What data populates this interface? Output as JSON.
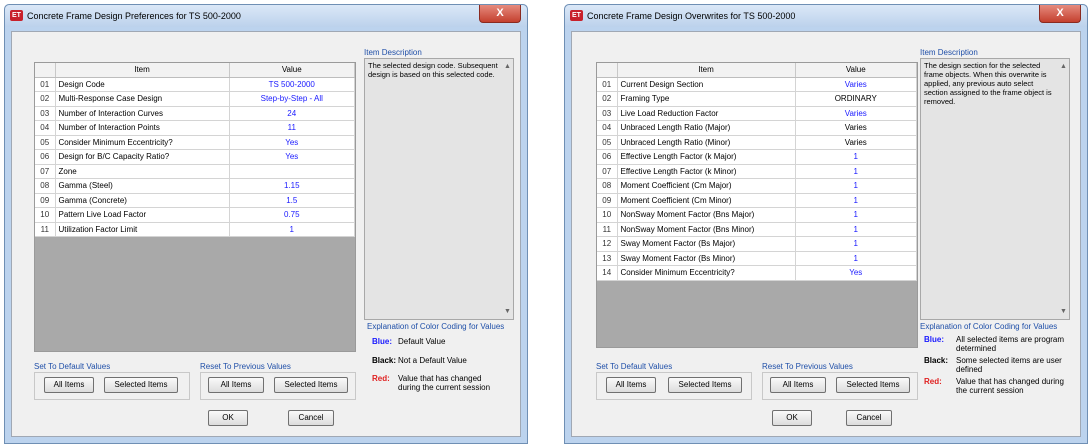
{
  "colors": {
    "blue": "#1a1aff",
    "black": "#000000",
    "red": "#e02020",
    "header_blue": "#1f4fa8"
  },
  "left": {
    "title": "Concrete Frame Design Preferences for TS 500-2000",
    "close_label": "X",
    "columns": {
      "item": "Item",
      "value": "Value"
    },
    "rows": [
      {
        "num": "01",
        "item": "Design Code",
        "value": "TS 500-2000",
        "color": "blue"
      },
      {
        "num": "02",
        "item": "Multi-Response Case Design",
        "value": "Step-by-Step - All",
        "color": "blue"
      },
      {
        "num": "03",
        "item": "Number of Interaction Curves",
        "value": "24",
        "color": "blue"
      },
      {
        "num": "04",
        "item": "Number of Interaction Points",
        "value": "11",
        "color": "blue"
      },
      {
        "num": "05",
        "item": "Consider Minimum Eccentricity?",
        "value": "Yes",
        "color": "blue"
      },
      {
        "num": "06",
        "item": "Design for B/C Capacity Ratio?",
        "value": "Yes",
        "color": "blue"
      },
      {
        "num": "07",
        "item": "Zone",
        "value": "",
        "color": "blue"
      },
      {
        "num": "08",
        "item": "Gamma (Steel)",
        "value": "1.15",
        "color": "blue"
      },
      {
        "num": "09",
        "item": "Gamma (Concrete)",
        "value": "1.5",
        "color": "blue"
      },
      {
        "num": "10",
        "item": "Pattern Live Load Factor",
        "value": "0.75",
        "color": "blue"
      },
      {
        "num": "11",
        "item": "Utilization Factor Limit",
        "value": "1",
        "color": "blue"
      }
    ],
    "item_description_label": "Item Description",
    "item_description": "The selected design code.  Subsequent design is based on this selected code.",
    "explanation_label": "Explanation of Color Coding for Values",
    "legend": [
      {
        "key": "Blue:",
        "text": "Default Value",
        "color": "blue"
      },
      {
        "key": "Black:",
        "text": "Not a Default Value",
        "color": "black"
      },
      {
        "key": "Red:",
        "text": "Value that has changed during the current session",
        "color": "red"
      }
    ],
    "set_default_label": "Set To Default Values",
    "reset_previous_label": "Reset To Previous Values",
    "all_items": "All Items",
    "selected_items": "Selected Items",
    "ok": "OK",
    "cancel": "Cancel"
  },
  "right": {
    "title": "Concrete Frame Design Overwrites for TS 500-2000",
    "close_label": "X",
    "columns": {
      "item": "Item",
      "value": "Value"
    },
    "rows": [
      {
        "num": "01",
        "item": "Current Design Section",
        "value": "Varies",
        "color": "blue"
      },
      {
        "num": "02",
        "item": "Framing Type",
        "value": "ORDINARY",
        "color": "black"
      },
      {
        "num": "03",
        "item": "Live Load Reduction Factor",
        "value": "Varies",
        "color": "blue"
      },
      {
        "num": "04",
        "item": "Unbraced Length Ratio (Major)",
        "value": "Varies",
        "color": "black"
      },
      {
        "num": "05",
        "item": "Unbraced Length Ratio (Minor)",
        "value": "Varies",
        "color": "black"
      },
      {
        "num": "06",
        "item": "Effective Length Factor (k Major)",
        "value": "1",
        "color": "blue"
      },
      {
        "num": "07",
        "item": "Effective Length Factor (k Minor)",
        "value": "1",
        "color": "blue"
      },
      {
        "num": "08",
        "item": "Moment Coefficient (Cm Major)",
        "value": "1",
        "color": "blue"
      },
      {
        "num": "09",
        "item": "Moment Coefficient (Cm Minor)",
        "value": "1",
        "color": "blue"
      },
      {
        "num": "10",
        "item": "NonSway Moment Factor (Bns Major)",
        "value": "1",
        "color": "blue"
      },
      {
        "num": "11",
        "item": "NonSway Moment Factor (Bns Minor)",
        "value": "1",
        "color": "blue"
      },
      {
        "num": "12",
        "item": "Sway Moment Factor (Bs Major)",
        "value": "1",
        "color": "blue"
      },
      {
        "num": "13",
        "item": "Sway Moment Factor (Bs Minor)",
        "value": "1",
        "color": "blue"
      },
      {
        "num": "14",
        "item": "Consider Minimum Eccentricity?",
        "value": "Yes",
        "color": "blue"
      }
    ],
    "item_description_label": "Item Description",
    "item_description": "The design section for the selected frame objects.  When this overwrite is applied, any previous auto select section assigned to the frame object is removed.",
    "explanation_label": "Explanation of Color Coding for Values",
    "legend": [
      {
        "key": "Blue:",
        "text": "All selected items are program determined",
        "color": "blue"
      },
      {
        "key": "Black:",
        "text": "Some selected items are user defined",
        "color": "black"
      },
      {
        "key": "Red:",
        "text": "Value that has changed during the current session",
        "color": "red"
      }
    ],
    "set_default_label": "Set To Default Values",
    "reset_previous_label": "Reset To Previous Values",
    "all_items": "All Items",
    "selected_items": "Selected Items",
    "ok": "OK",
    "cancel": "Cancel"
  }
}
